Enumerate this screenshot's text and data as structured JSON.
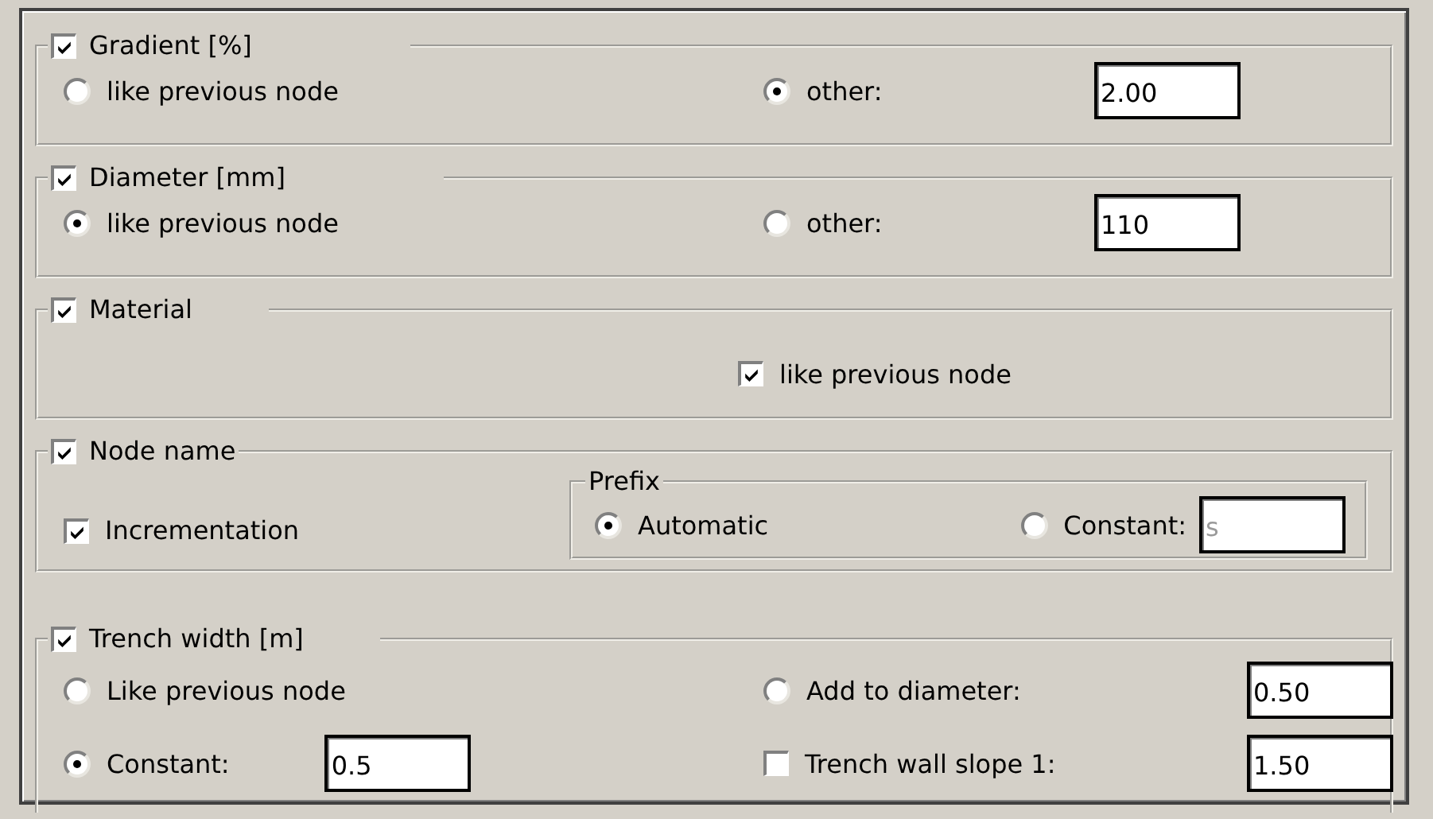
{
  "groups": [
    {
      "kind": "choice",
      "title": {
        "label": "Gradient [%]",
        "checked": true
      },
      "rows": [
        {
          "cells": [
            [
              {
                "kind": "radio",
                "label": "like previous node",
                "selected": false
              }
            ],
            [
              {
                "kind": "radio",
                "label": "other:",
                "selected": true
              },
              {
                "kind": "field",
                "value": "2.00",
                "disabled": false
              }
            ]
          ]
        }
      ]
    },
    {
      "kind": "choice",
      "title": {
        "label": "Diameter [mm]",
        "checked": true
      },
      "rows": [
        {
          "cells": [
            [
              {
                "kind": "radio",
                "label": "like previous node",
                "selected": true
              }
            ],
            [
              {
                "kind": "radio",
                "label": "other:",
                "selected": false
              },
              {
                "kind": "field",
                "value": "110",
                "disabled": false
              }
            ]
          ]
        }
      ]
    },
    {
      "kind": "flag",
      "title": {
        "label": "Material",
        "checked": true
      },
      "rows": [
        {
          "cells": [
            [
              {
                "kind": "checkbox",
                "label": "like previous node",
                "checked": true
              }
            ]
          ]
        }
      ]
    },
    {
      "kind": "nested",
      "title": {
        "label": "Node name",
        "checked": true
      },
      "rows": [
        {
          "cells": [
            [
              {
                "kind": "checkbox",
                "label": "Incrementation",
                "checked": true
              }
            ],
            [
              {
                "kind": "group",
                "title": "Prefix",
                "items": [
                  {
                    "kind": "radio",
                    "label": "Automatic",
                    "selected": true
                  },
                  {
                    "kind": "radio",
                    "label": "Constant:",
                    "selected": false
                  },
                  {
                    "kind": "field",
                    "value": "s",
                    "disabled": true
                  }
                ]
              }
            ]
          ]
        }
      ]
    },
    {
      "kind": "trench",
      "title": {
        "label": "Trench width [m]",
        "checked": true
      },
      "rows": [
        {
          "cells": [
            [
              {
                "kind": "radio",
                "label": "Like previous node",
                "selected": false
              }
            ],
            [
              {
                "kind": "radio",
                "label": "Add to diameter:",
                "selected": false
              },
              {
                "kind": "field",
                "value": "0.50",
                "disabled": false
              }
            ]
          ]
        },
        {
          "cells": [
            [
              {
                "kind": "radio",
                "label": "Constant:",
                "selected": true
              },
              {
                "kind": "field",
                "value": "0.5",
                "disabled": false
              }
            ],
            [
              {
                "kind": "checkbox",
                "label": "Trench wall slope 1:",
                "checked": false
              },
              {
                "kind": "field",
                "value": "1.50",
                "disabled": false
              }
            ]
          ]
        }
      ]
    }
  ]
}
